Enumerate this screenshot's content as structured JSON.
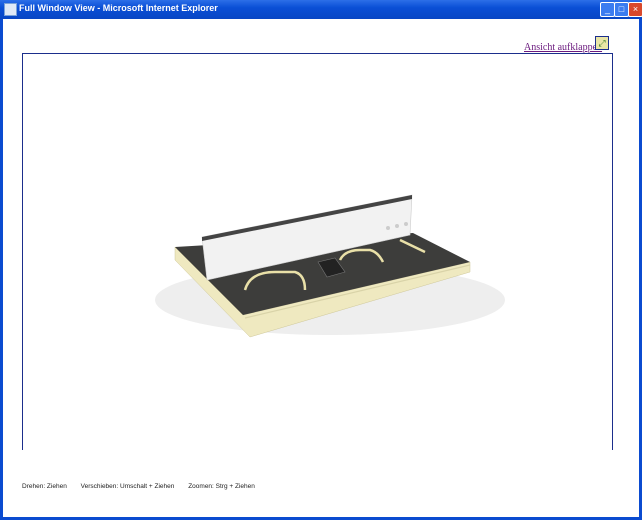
{
  "window": {
    "title": "Full Window View - Microsoft Internet Explorer",
    "minimize": "_",
    "maximize": "□",
    "close": "×"
  },
  "toolbar": {
    "expand_link": "Ansicht aufklappen",
    "expand_icon": "expand-icon"
  },
  "viewer": {
    "model": "3D product model"
  },
  "hints": {
    "rotate": "Drehen: Ziehen",
    "pan": "Verschieben: Umschalt + Ziehen",
    "zoom": "Zoomen: Strg + Ziehen"
  }
}
